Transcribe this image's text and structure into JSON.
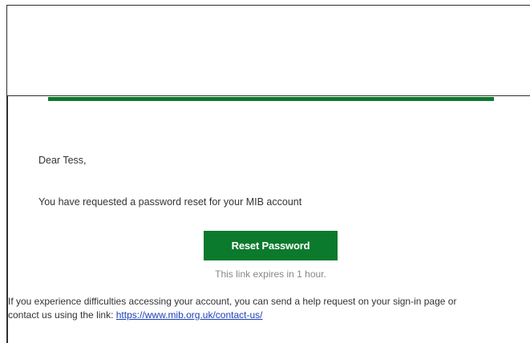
{
  "email": {
    "greeting": "Dear Tess,",
    "message": "You have requested a password reset for your MIB account",
    "button_label": "Reset Password",
    "expiry_note": "This link expires in 1 hour.",
    "help_line_1": "If you experience difficulties accessing your account, you can send a help request on your sign-in page or",
    "help_line_2_prefix": "contact us using the link: ",
    "help_link": "https://www.mib.org.uk/contact-us/"
  },
  "colors": {
    "accent_green": "#0b7a2c",
    "link_blue": "#1a3fb5",
    "muted_text": "#888888"
  }
}
